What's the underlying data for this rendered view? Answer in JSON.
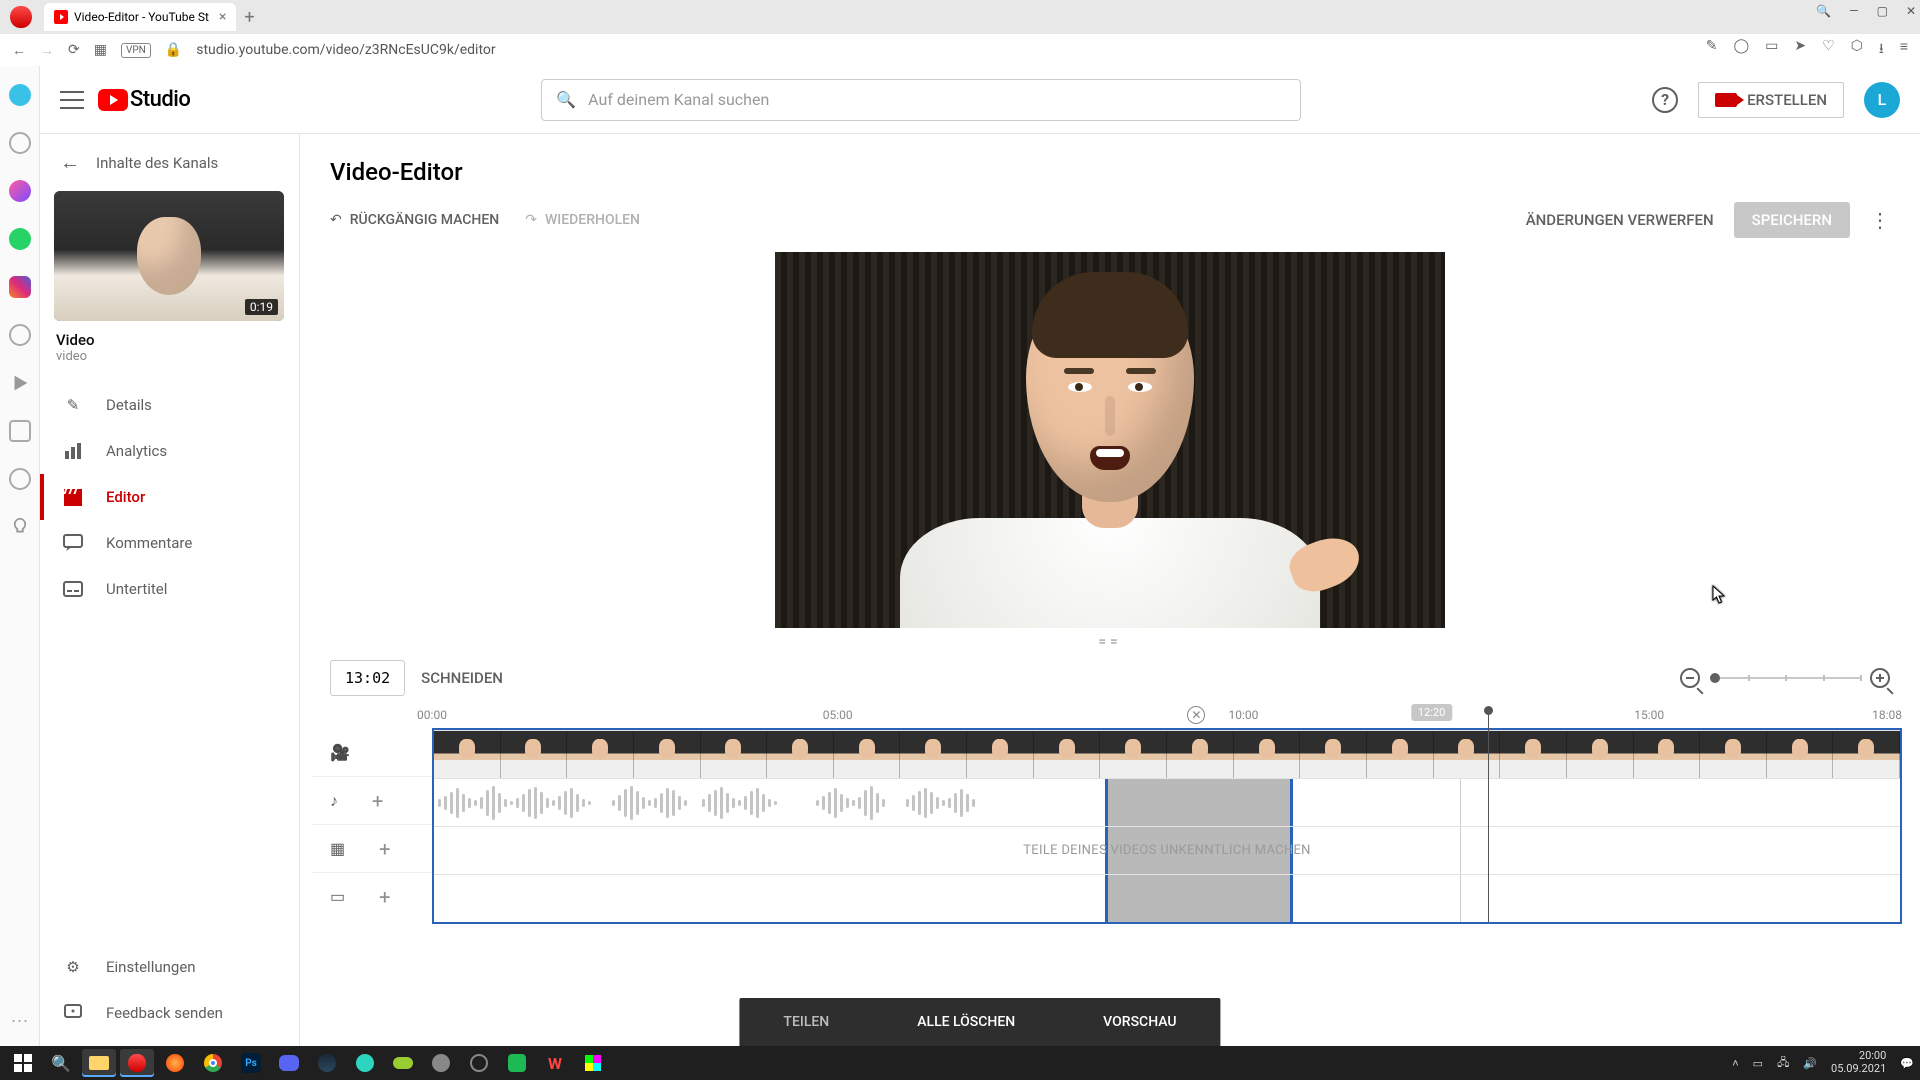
{
  "browser": {
    "tab_title": "Video-Editor - YouTube St",
    "url": "studio.youtube.com/video/z3RNcEsUC9k/editor"
  },
  "header": {
    "logo_text": "Studio",
    "search_placeholder": "Auf deinem Kanal suchen",
    "create_label": "ERSTELLEN",
    "avatar_letter": "L"
  },
  "sidebar": {
    "back_label": "Inhalte des Kanals",
    "video_duration": "0:19",
    "video_title": "Video",
    "video_sub": "video",
    "nav": [
      {
        "label": "Details"
      },
      {
        "label": "Analytics"
      },
      {
        "label": "Editor"
      },
      {
        "label": "Kommentare"
      },
      {
        "label": "Untertitel"
      }
    ],
    "settings": "Einstellungen",
    "feedback": "Feedback senden"
  },
  "editor": {
    "title": "Video-Editor",
    "undo": "RÜCKGÄNGIG MACHEN",
    "redo": "WIEDERHOLEN",
    "discard": "ÄNDERUNGEN VERWERFEN",
    "save": "SPEICHERN",
    "timecode": "13:02",
    "cut": "SCHNEIDEN",
    "blur_hint": "TEILE DEINES VIDEOS UNKENNTLICH MACHEN",
    "ruler": {
      "t0": "00:00",
      "t5": "05:00",
      "t10": "10:00",
      "t15": "15:00",
      "end": "18:08",
      "pill": "12:20"
    },
    "bottom": {
      "split": "TEILEN",
      "clear": "ALLE LÖSCHEN",
      "preview": "VORSCHAU"
    }
  },
  "taskbar": {
    "time": "20:00",
    "date": "05.09.2021"
  }
}
